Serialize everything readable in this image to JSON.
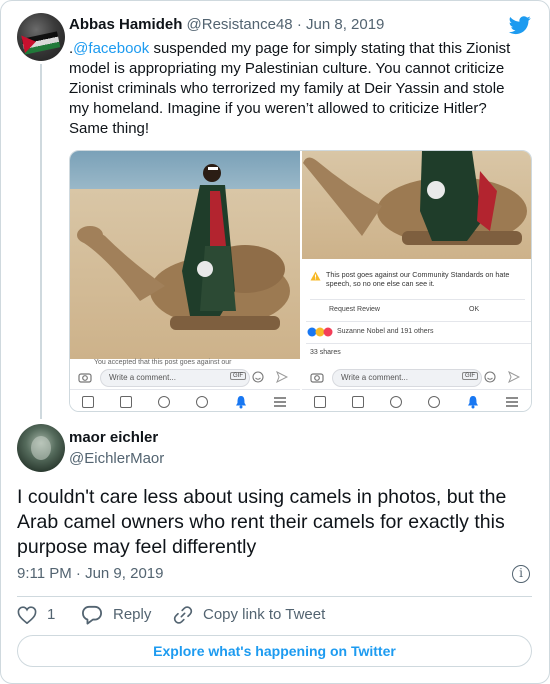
{
  "quoted_tweet": {
    "author_name": "Abbas Hamideh",
    "author_handle": "@Resistance48",
    "date_sep": " · ",
    "date": "Jun 8, 2019",
    "mention": "@facebook",
    "text_prefix": ".",
    "text_rest": " suspended my page for simply stating that this Zionist model is appropriating my Palestinian culture. You cannot criticize Zionist criminals who terrorized my family at Deir Yassin and stole my homeland. Imagine if you weren’t allowed to criticize Hitler? Same thing!",
    "media": {
      "left_comment_placeholder": "Write a comment...",
      "right_comment_placeholder": "Write a comment...",
      "left_snippet": "You accepted that this post goes against our",
      "warning_text": "This post goes against our Community Standards on hate speech, so no one else can see it.",
      "request_review": "Request Review",
      "ok": "OK",
      "reactions": "Suzanne Nobel and 191 others",
      "shares": "33 shares",
      "gif_label": "GIF"
    }
  },
  "tweet": {
    "author_name": "maor eichler",
    "author_handle": "@EichlerMaor",
    "text": "I couldn't care less about using camels in photos, but the Arab camel owners who rent their camels for exactly this purpose may feel differently",
    "timestamp": "9:11 PM · Jun 9, 2019",
    "info_icon": "i",
    "like_count": "1",
    "reply_label": "Reply",
    "copy_link_label": "Copy link to Tweet",
    "cta_label": "Explore what's happening on Twitter"
  },
  "colors": {
    "accent": "#1d9bf0",
    "secondary_text": "#536471",
    "border": "#cfd9de"
  }
}
